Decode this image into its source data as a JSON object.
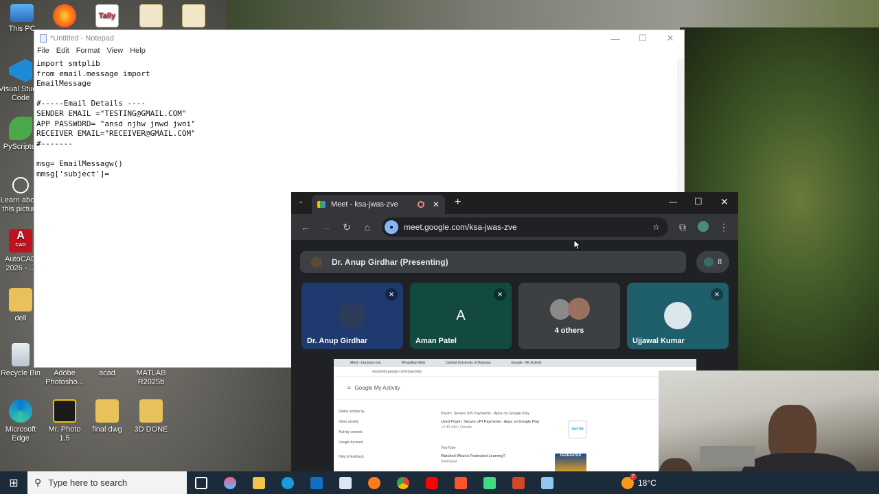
{
  "desktop": {
    "icons": [
      {
        "label": "This PC"
      },
      {
        "label": "Visual Studio Code"
      },
      {
        "label": "PyScripter"
      },
      {
        "label": "Learn about this picture"
      },
      {
        "label": "AutoCAD 2026 - ..."
      },
      {
        "label": "dell"
      },
      {
        "label": "Recycle Bin"
      },
      {
        "label": "Adobe Photosho..."
      },
      {
        "label": "acad"
      },
      {
        "label": "MATLAB R2025b"
      },
      {
        "label": "Microsoft Edge"
      },
      {
        "label": "Mr. Photo 1.5"
      },
      {
        "label": "final dwg"
      },
      {
        "label": "3D DONE"
      }
    ],
    "tally_label": "Tally",
    "autocad_letter": "A",
    "autocad_badge": "CAD"
  },
  "notepad": {
    "title": "*Untitled - Notepad",
    "menu": [
      "File",
      "Edit",
      "Format",
      "View",
      "Help"
    ],
    "lines": [
      "import smtplib",
      "from email.message import",
      "EmailMessage",
      "",
      "#-----Email Details ----",
      "SENDER EMAIL =\"TESTING@GMAIL.COM\"",
      "APP PASSWORD= \"ansd njhw jnwd jwni\"",
      "RECEIVER EMAIL=\"RECEIVER@GMAIL.COM\"",
      "#-------",
      "",
      "msg= EmailMessagw()",
      "mmsg['subject']="
    ]
  },
  "chrome": {
    "tab_title": "Meet - ksa-jwas-zve",
    "url": "meet.google.com/ksa-jwas-zve"
  },
  "meet": {
    "presenter": "Dr. Anup Girdhar (Presenting)",
    "participant_count": "8",
    "tiles": [
      {
        "name": "Dr. Anup Girdhar",
        "bg": "#1e3a6e"
      },
      {
        "name": "Aman Patel",
        "initial": "A",
        "bg": "#134a40"
      },
      {
        "name": "4 others",
        "bg": "#3c4043"
      },
      {
        "name": "Ujjawal Kumar",
        "bg": "#1f5f6b"
      }
    ]
  },
  "shared_screen": {
    "tabs": [
      "Meet - ksa-jwas-zve",
      "WhatsApp Web",
      "Central University of Haryana",
      "Google - My Activity"
    ],
    "url": "myactivity.google.com/myactivity",
    "heading": "Google My Activity",
    "side": [
      "Delete activity by",
      "Other activity",
      "Activity controls",
      "Google Account",
      "Help & feedback"
    ],
    "card1_source": "Paytm: Secure UPI Payments - Apps on Google Play",
    "card1_line": "Used Paytm: Secure UPI Payments - Apps on Google Play",
    "card1_meta": "12:46 AM • Details",
    "card1_thumb": "PAYTM",
    "card2_source": "YouTube",
    "card2_line": "Watched What is Federated Learning?",
    "card2_meta": "Intellipaat",
    "card2_thumb": "FEDERATED"
  },
  "taskbar": {
    "search_placeholder": "Type here to search",
    "temperature": "18°C",
    "notification_count": "7"
  }
}
